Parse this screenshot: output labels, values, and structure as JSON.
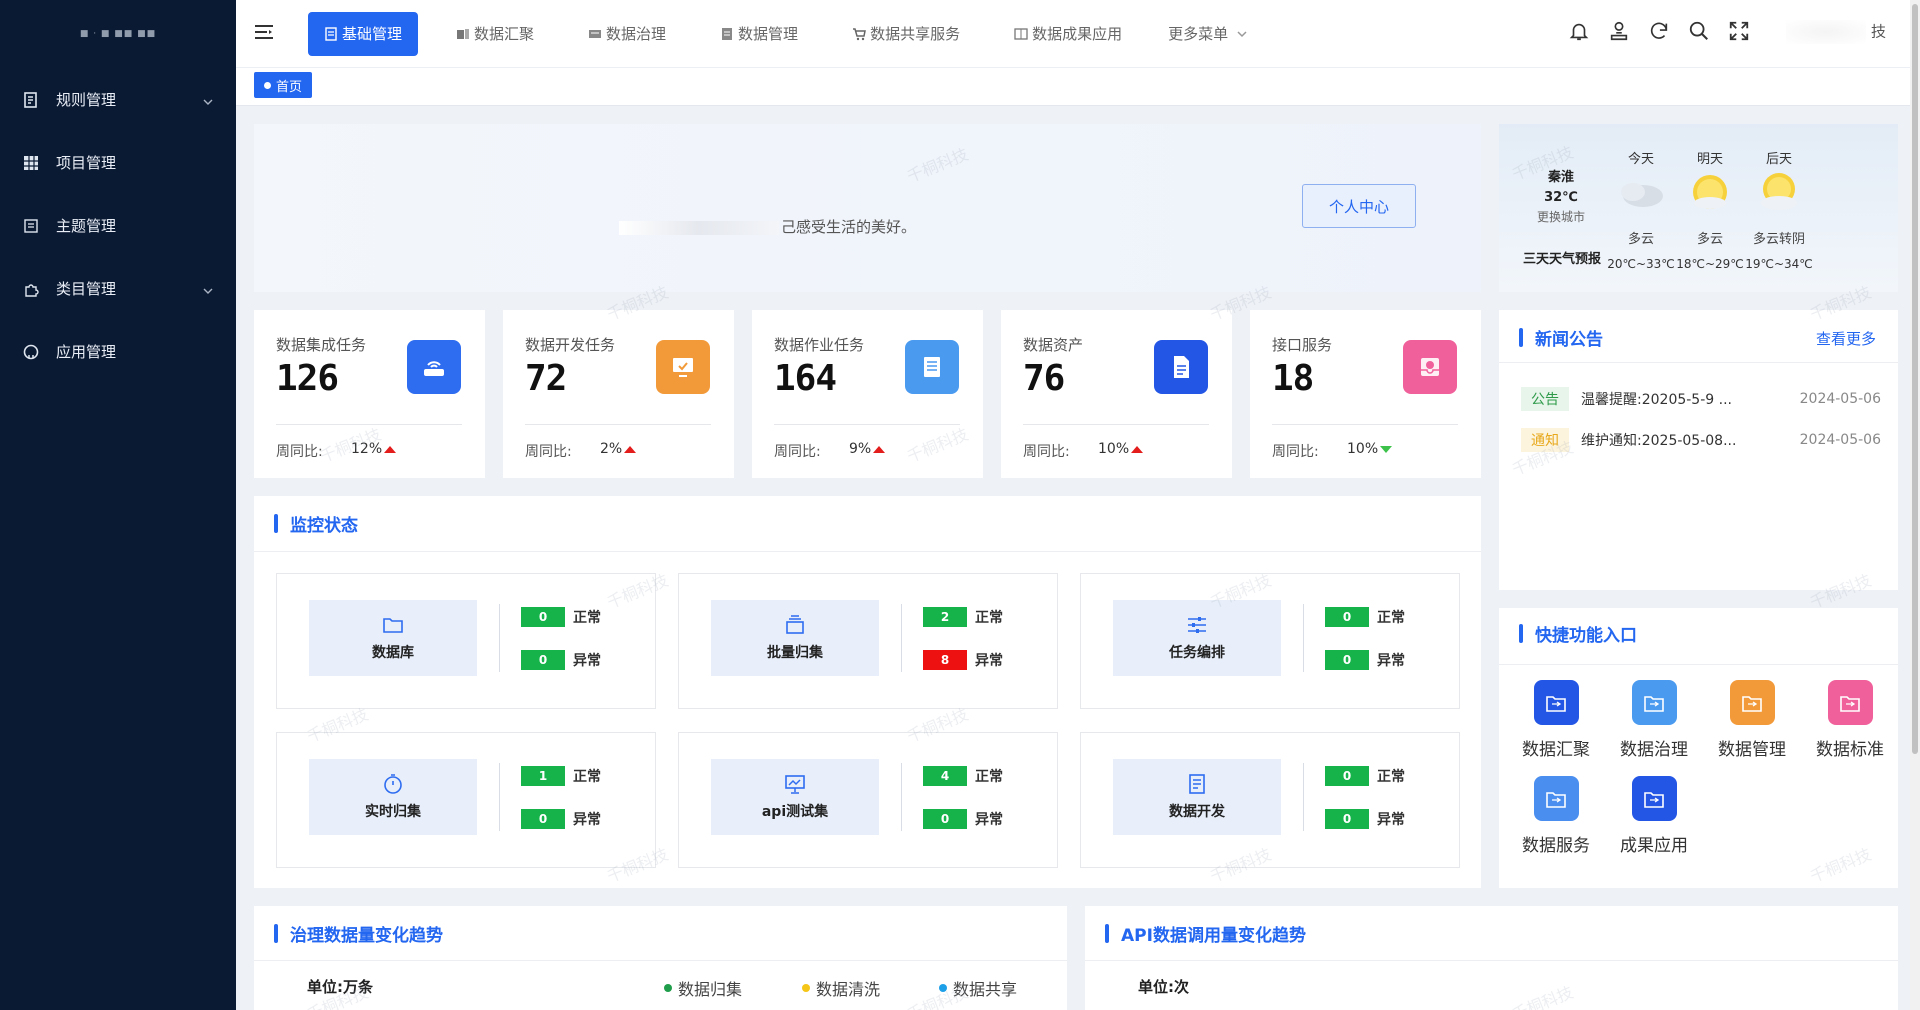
{
  "sidebar": {
    "logo_text": "■ · ■ ■■ ■■",
    "items": [
      {
        "label": "规则管理",
        "icon": "ledger-icon",
        "has_submenu": true
      },
      {
        "label": "项目管理",
        "icon": "grid-icon",
        "has_submenu": false
      },
      {
        "label": "主题管理",
        "icon": "document-icon",
        "has_submenu": false
      },
      {
        "label": "类目管理",
        "icon": "puzzle-icon",
        "has_submenu": true
      },
      {
        "label": "应用管理",
        "icon": "github-icon",
        "has_submenu": false
      }
    ]
  },
  "topnav": {
    "tabs": [
      {
        "label": "基础管理",
        "active": true
      },
      {
        "label": "数据汇聚",
        "active": false
      },
      {
        "label": "数据治理",
        "active": false
      },
      {
        "label": "数据管理",
        "active": false
      },
      {
        "label": "数据共享服务",
        "active": false
      },
      {
        "label": "数据成果应用",
        "active": false
      }
    ],
    "more_label": "更多菜单",
    "user_name": "技"
  },
  "breadcrumb": {
    "label": "首页"
  },
  "welcome": {
    "text": "己感受生活的美好。",
    "button_label": "个人中心"
  },
  "weather": {
    "city": "秦淮",
    "temp_now": "32℃",
    "change_city": "更换城市",
    "forecast_title": "三天天气预报",
    "days": [
      {
        "label": "今天",
        "cond": "多云",
        "temp": "20℃~33℃",
        "icon": "cloudy-icon"
      },
      {
        "label": "明天",
        "cond": "多云",
        "temp": "18℃~29℃",
        "icon": "sunny-icon"
      },
      {
        "label": "后天",
        "cond": "多云转阴",
        "temp": "19℃~34℃",
        "icon": "sun-cloud-icon"
      }
    ]
  },
  "stats": [
    {
      "title": "数据集成任务",
      "value": "126",
      "wow_label": "周同比:",
      "pct": "12%",
      "trend": "up",
      "icon": "router-icon",
      "color": "#2e6cf0"
    },
    {
      "title": "数据开发任务",
      "value": "72",
      "wow_label": "周同比:",
      "pct": "2%",
      "trend": "up",
      "icon": "monitor-icon",
      "color": "#f29a3a"
    },
    {
      "title": "数据作业任务",
      "value": "164",
      "wow_label": "周同比:",
      "pct": "9%",
      "trend": "up",
      "icon": "book-icon",
      "color": "#4a9af0"
    },
    {
      "title": "数据资产",
      "value": "76",
      "wow_label": "周同比:",
      "pct": "10%",
      "trend": "up",
      "icon": "file-icon",
      "color": "#2456e6"
    },
    {
      "title": "接口服务",
      "value": "18",
      "wow_label": "周同比:",
      "pct": "10%",
      "trend": "down",
      "icon": "inbox-icon",
      "color": "#f0609a"
    }
  ],
  "news": {
    "title": "新闻公告",
    "more_label": "查看更多",
    "items": [
      {
        "tag": "公告",
        "tag_type": "notice",
        "text": "温馨提醒:20205-5-9 ...",
        "date": "2024-05-06"
      },
      {
        "tag": "通知",
        "tag_type": "inform",
        "text": "维护通知:2025-05-08...",
        "date": "2024-05-06"
      }
    ]
  },
  "monitor": {
    "title": "监控状态",
    "normal_label": "正常",
    "abnormal_label": "异常",
    "items": [
      {
        "label": "数据库",
        "icon": "folder-icon",
        "normal": "0",
        "abnormal": "0"
      },
      {
        "label": "批量归集",
        "icon": "layers-icon",
        "normal": "2",
        "abnormal": "8"
      },
      {
        "label": "任务编排",
        "icon": "sliders-icon",
        "normal": "0",
        "abnormal": "0"
      },
      {
        "label": "实时归集",
        "icon": "stopwatch-icon",
        "normal": "1",
        "abnormal": "0"
      },
      {
        "label": "api测试集",
        "icon": "presentation-icon",
        "normal": "4",
        "abnormal": "0"
      },
      {
        "label": "数据开发",
        "icon": "list-doc-icon",
        "normal": "0",
        "abnormal": "0"
      }
    ]
  },
  "quick": {
    "title": "快捷功能入口",
    "items": [
      {
        "label": "数据汇聚",
        "color": "#2456e6"
      },
      {
        "label": "数据治理",
        "color": "#4a9af0"
      },
      {
        "label": "数据管理",
        "color": "#f29a3a"
      },
      {
        "label": "数据标准",
        "color": "#f0609a"
      },
      {
        "label": "数据服务",
        "color": "#4a8ef0"
      },
      {
        "label": "成果应用",
        "color": "#2456e6"
      }
    ]
  },
  "trend_left": {
    "title": "治理数据量变化趋势",
    "unit": "单位:万条",
    "legend": [
      {
        "label": "数据归集",
        "color": "#1f9d4a"
      },
      {
        "label": "数据清洗",
        "color": "#f5c518"
      },
      {
        "label": "数据共享",
        "color": "#1ea0e8"
      }
    ]
  },
  "trend_right": {
    "title": "API数据调用量变化趋势",
    "unit": "单位:次"
  },
  "watermark": "千桐科技"
}
